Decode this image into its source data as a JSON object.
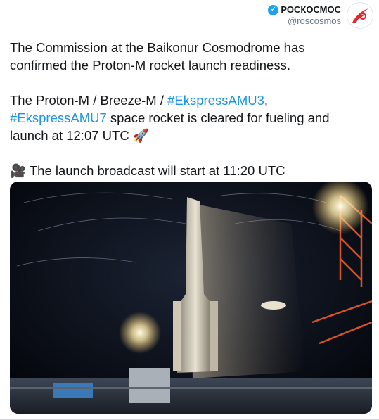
{
  "author": {
    "name": "РОСКОСМОС",
    "handle": "@roscosmos",
    "verified": true
  },
  "tweet": {
    "p1_line1": "The Commission at the Baikonur Cosmodrome has",
    "p1_line2": "confirmed the Proton-M rocket launch readiness.",
    "p2_prefix": "The Proton-M / Breeze-M / ",
    "hashtag1": "#EkspressAMU3",
    "comma": ",",
    "hashtag2": "#EkspressAMU7",
    "p2_mid": " space rocket is cleared for fueling and",
    "p2_line3": "launch at 12:07 UTC ",
    "rocket_emoji": "🚀",
    "camera_emoji": "🎥",
    "p3": " The launch broadcast will start at 11:20 UTC"
  },
  "colors": {
    "link": "#1b95e0",
    "verified": "#1da1f2",
    "logo_red": "#e3262c"
  },
  "icons": {
    "verified": "verified-badge-icon",
    "logo": "roscosmos-logo-icon"
  }
}
